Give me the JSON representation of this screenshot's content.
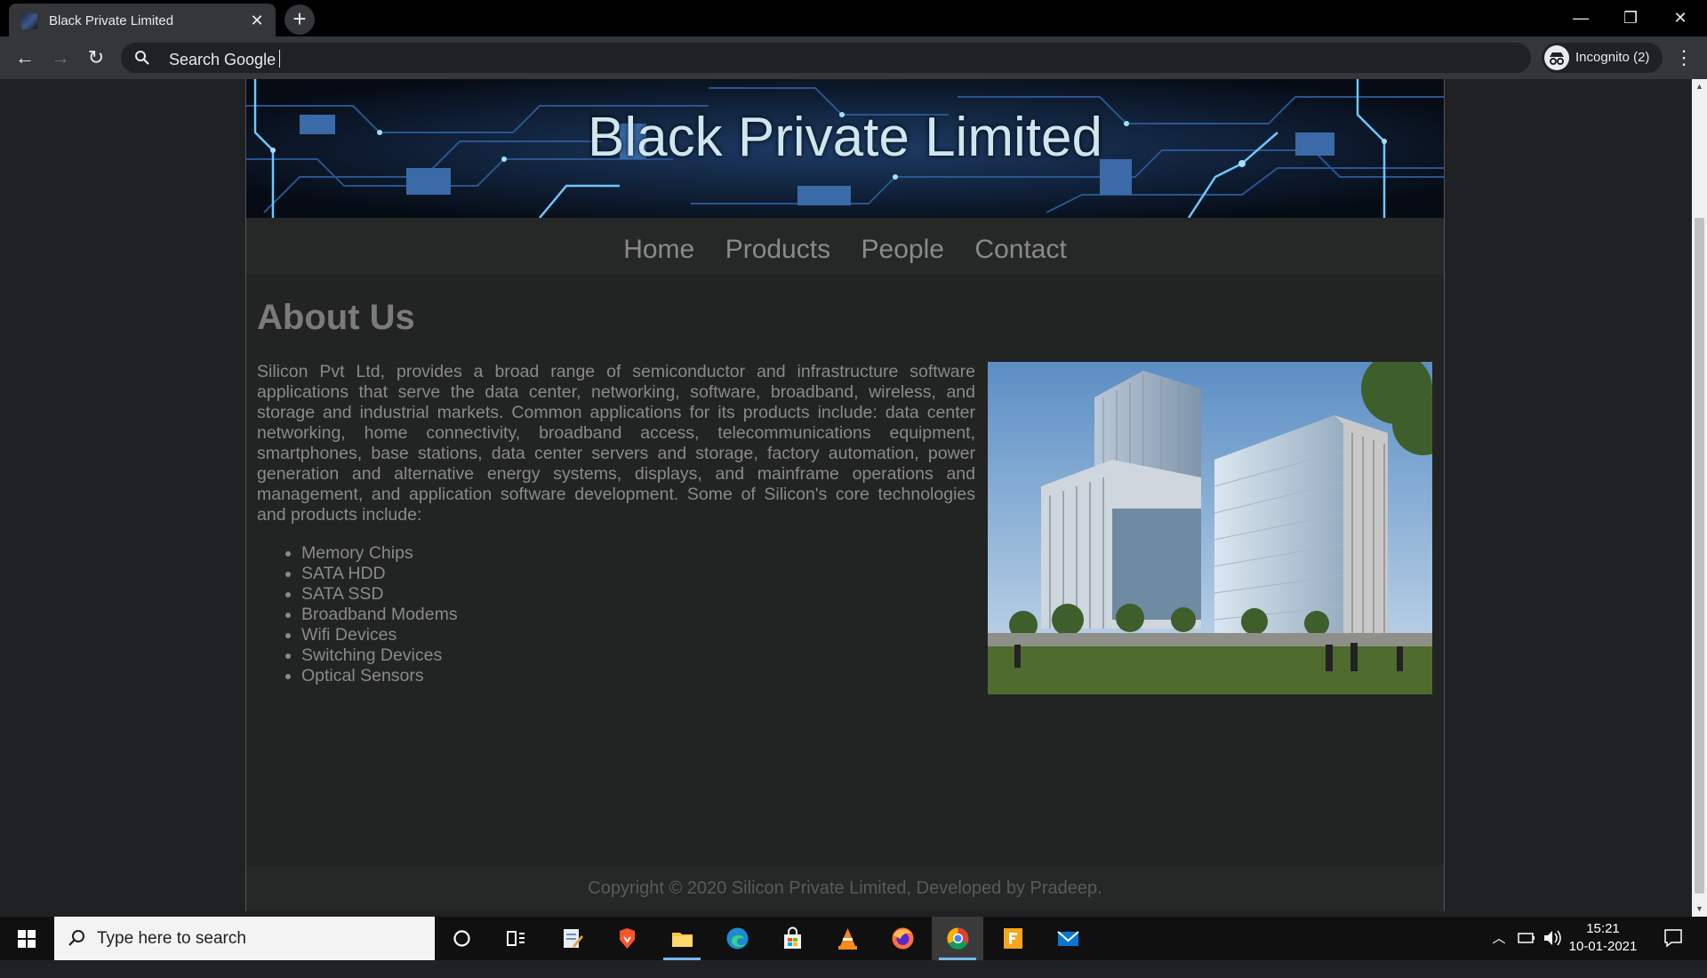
{
  "browser": {
    "tab_title": "Black Private Limited",
    "tab_close_icon": "close-icon",
    "new_tab_icon": "plus-icon",
    "address_text": "Search Google",
    "profile_label": "Incognito (2)",
    "window_controls": [
      "minimize-icon",
      "restore-icon",
      "close-icon"
    ]
  },
  "site": {
    "banner_title": "Black Private Limited",
    "nav": [
      "Home",
      "Products",
      "People",
      "Contact"
    ],
    "about": {
      "heading": "About Us",
      "paragraph": "Silicon Pvt Ltd, provides a broad range of semiconductor and infrastructure software applications that serve the data center, networking, software, broadband, wireless, and storage and industrial markets. Common applications for its products include: data center networking, home connectivity, broadband access, telecommunications equipment, smartphones, base stations, data center servers and storage, factory automation, power generation and alternative energy systems, displays, and mainframe operations and management, and application software development. Some of Silicon's core technologies and products include:",
      "products": [
        "Memory Chips",
        "SATA HDD",
        "SATA SSD",
        "Broadband Modems",
        "Wifi Devices",
        "Switching Devices",
        "Optical Sensors"
      ]
    },
    "footer": "Copyright © 2020 Silicon Private Limited, Developed by Pradeep."
  },
  "taskbar": {
    "search_placeholder": "Type here to search",
    "apps": [
      "cortana-icon",
      "task-view-icon",
      "notepad-icon",
      "brave-icon",
      "file-explorer-icon",
      "edge-icon",
      "store-icon",
      "vlc-icon",
      "firefox-icon",
      "chrome-icon",
      "foxit-icon",
      "mail-icon"
    ],
    "time": "15:21",
    "date": "10-01-2021"
  },
  "colors": {
    "page_bg": "#202124",
    "site_bg": "#222323",
    "nav_text": "#8a8a8a",
    "banner_text": "#cfe6ef"
  }
}
